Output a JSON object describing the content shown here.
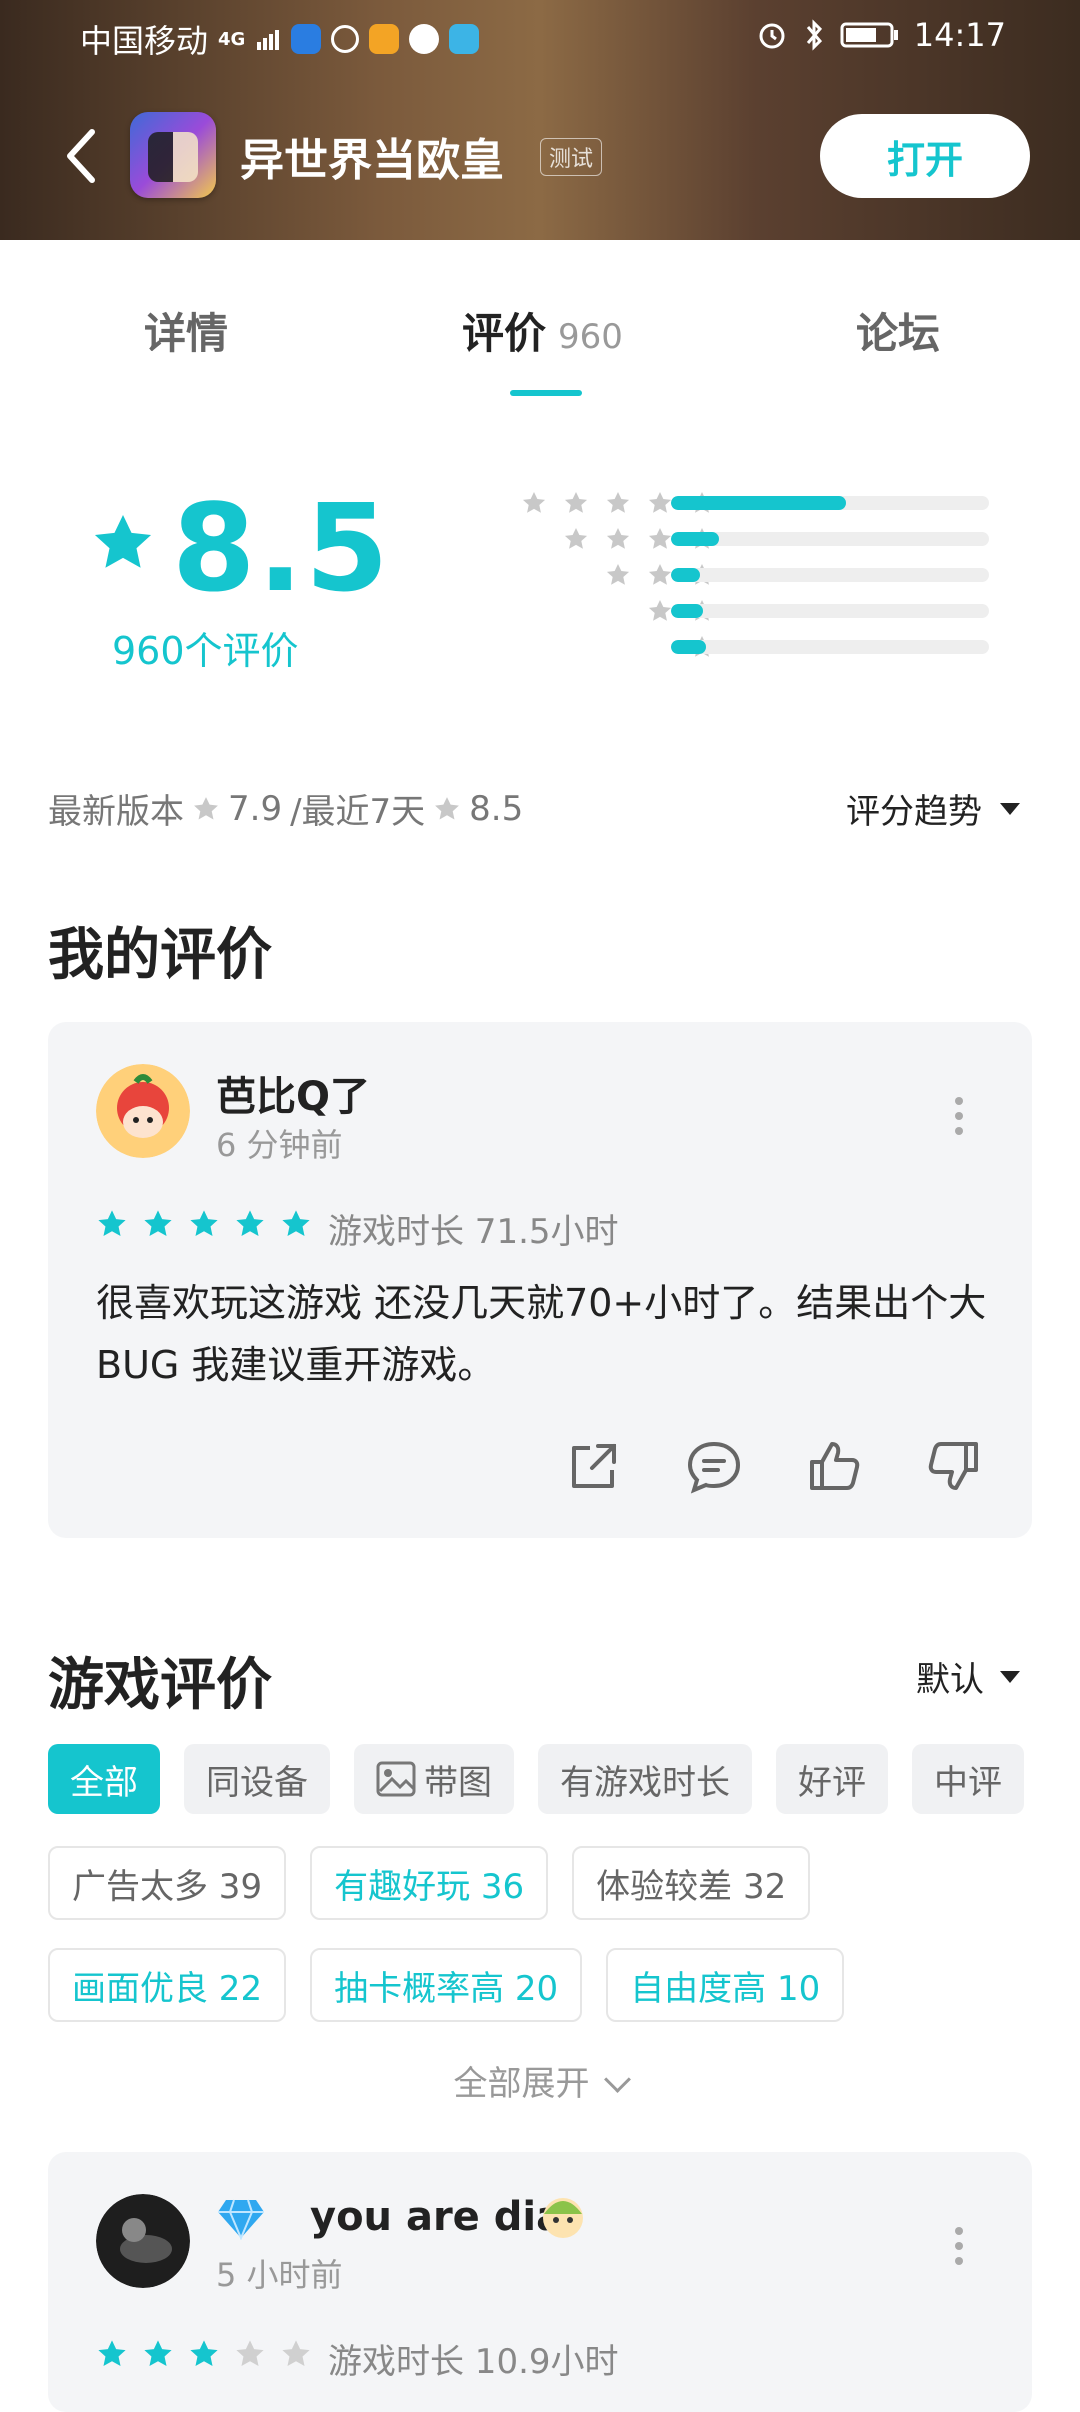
{
  "status_bar": {
    "carrier": "中国移动",
    "network": "4G",
    "time": "14:17"
  },
  "app_bar": {
    "title": "异世界当欧皇",
    "badge": "测试",
    "open_label": "打开"
  },
  "tabs": [
    {
      "label": "详情"
    },
    {
      "label": "评价",
      "count": "960"
    },
    {
      "label": "论坛"
    }
  ],
  "rating": {
    "score": "8.5",
    "count_label": "960个评价",
    "distribution": [
      {
        "stars": 5,
        "fraction": 0.55
      },
      {
        "stars": 4,
        "fraction": 0.15
      },
      {
        "stars": 3,
        "fraction": 0.09
      },
      {
        "stars": 2,
        "fraction": 0.1
      },
      {
        "stars": 1,
        "fraction": 0.11
      }
    ],
    "latest_version_label": "最新版本",
    "latest_version_score": "7.9",
    "recent_label": "/最近7天",
    "recent_score": "8.5",
    "trend_label": "评分趋势"
  },
  "my_review": {
    "section_title": "我的评价",
    "user": "芭比Q了",
    "time": "6 分钟前",
    "stars": 5,
    "playtime": "游戏时长 71.5小时",
    "text": "很喜欢玩这游戏 还没几天就70+小时了。结果出个大BUG 我建议重开游戏。"
  },
  "game_reviews": {
    "section_title": "游戏评价",
    "sort_label": "默认",
    "filters": [
      {
        "label": "全部",
        "active": true
      },
      {
        "label": "同设备"
      },
      {
        "label": "带图",
        "icon": "image-icon"
      },
      {
        "label": "有游戏时长"
      },
      {
        "label": "好评"
      },
      {
        "label": "中评"
      }
    ],
    "tags_row1": [
      {
        "label": "广告太多 39",
        "teal": false
      },
      {
        "label": "有趣好玩 36",
        "teal": true
      },
      {
        "label": "体验较差 32",
        "teal": false
      }
    ],
    "tags_row2": [
      {
        "label": "画面优良 22",
        "teal": true
      },
      {
        "label": "抽卡概率高 20",
        "teal": true
      },
      {
        "label": "自由度高 10",
        "teal": true
      }
    ],
    "expand_label": "全部展开"
  },
  "second_review": {
    "user": "you are  dia",
    "time": "5 小时前",
    "stars": 3,
    "playtime": "游戏时长 10.9小时"
  },
  "colors": {
    "accent": "#15c5ce",
    "star_gray": "#c8c8c8",
    "card_bg": "#f4f5f7"
  }
}
